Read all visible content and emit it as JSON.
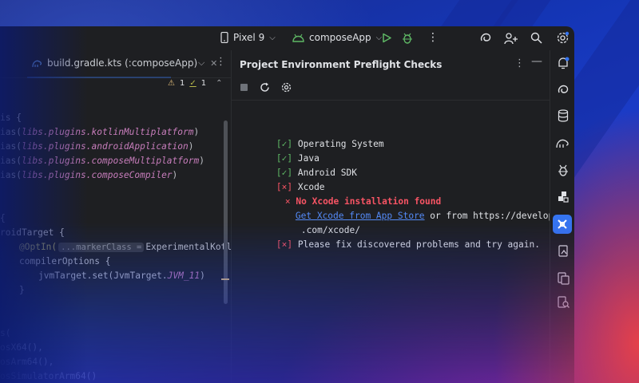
{
  "toolbar": {
    "device": "Pixel 9",
    "config": "composeApp"
  },
  "editor": {
    "tab_label": "build.gradle.kts (:composeApp)",
    "warnings_count": "1",
    "weak_warnings_count": "1",
    "code_lines": {
      "l1": "is {",
      "l2a": "ias(",
      "l2b": "libs.plugins.kotlinMultiplatform",
      "l2c": ")",
      "l3a": "ias(",
      "l3b": "libs.plugins.androidApplication",
      "l3c": ")",
      "l4a": "ias(",
      "l4b": "libs.plugins.composeMultiplatform",
      "l4c": ")",
      "l5a": "ias(",
      "l5b": "libs.plugins.composeCompiler",
      "l5c": ")",
      "l6": "{",
      "l7": "roidTarget {",
      "l8a": "@OptIn(",
      "l8hint": "...markerClass =",
      "l8b": "ExperimentalKotlinGra",
      "l9": "compilerOptions {",
      "l10a": "jvmTarget.set(JvmTarget.",
      "l10b": "JVM_11",
      "l10c": ")",
      "l11": "}",
      "l12": "s(",
      "l13": "osX64(),",
      "l14": "osArm64(),",
      "l15": "osSimulatorArm64()"
    }
  },
  "toolwindow": {
    "title": "Project Environment Preflight Checks",
    "checks": [
      {
        "status": "[✓]",
        "label": "Operating System"
      },
      {
        "status": "[✓]",
        "label": "Java"
      },
      {
        "status": "[✓]",
        "label": "Android SDK"
      },
      {
        "status": "[×]",
        "label": "Xcode"
      }
    ],
    "error_mark": "×",
    "error_message": "No Xcode installation found",
    "link_text": "Get Xcode from App Store",
    "link_suffix": " or from https://developer.apple",
    "link_cont": ".com/xcode/",
    "final_status": "[×]",
    "final_message": "Please fix discovered problems and try again."
  },
  "colors": {
    "accent": "#3574f0",
    "success": "#5fb865",
    "error": "#f75464",
    "link": "#548af7"
  }
}
